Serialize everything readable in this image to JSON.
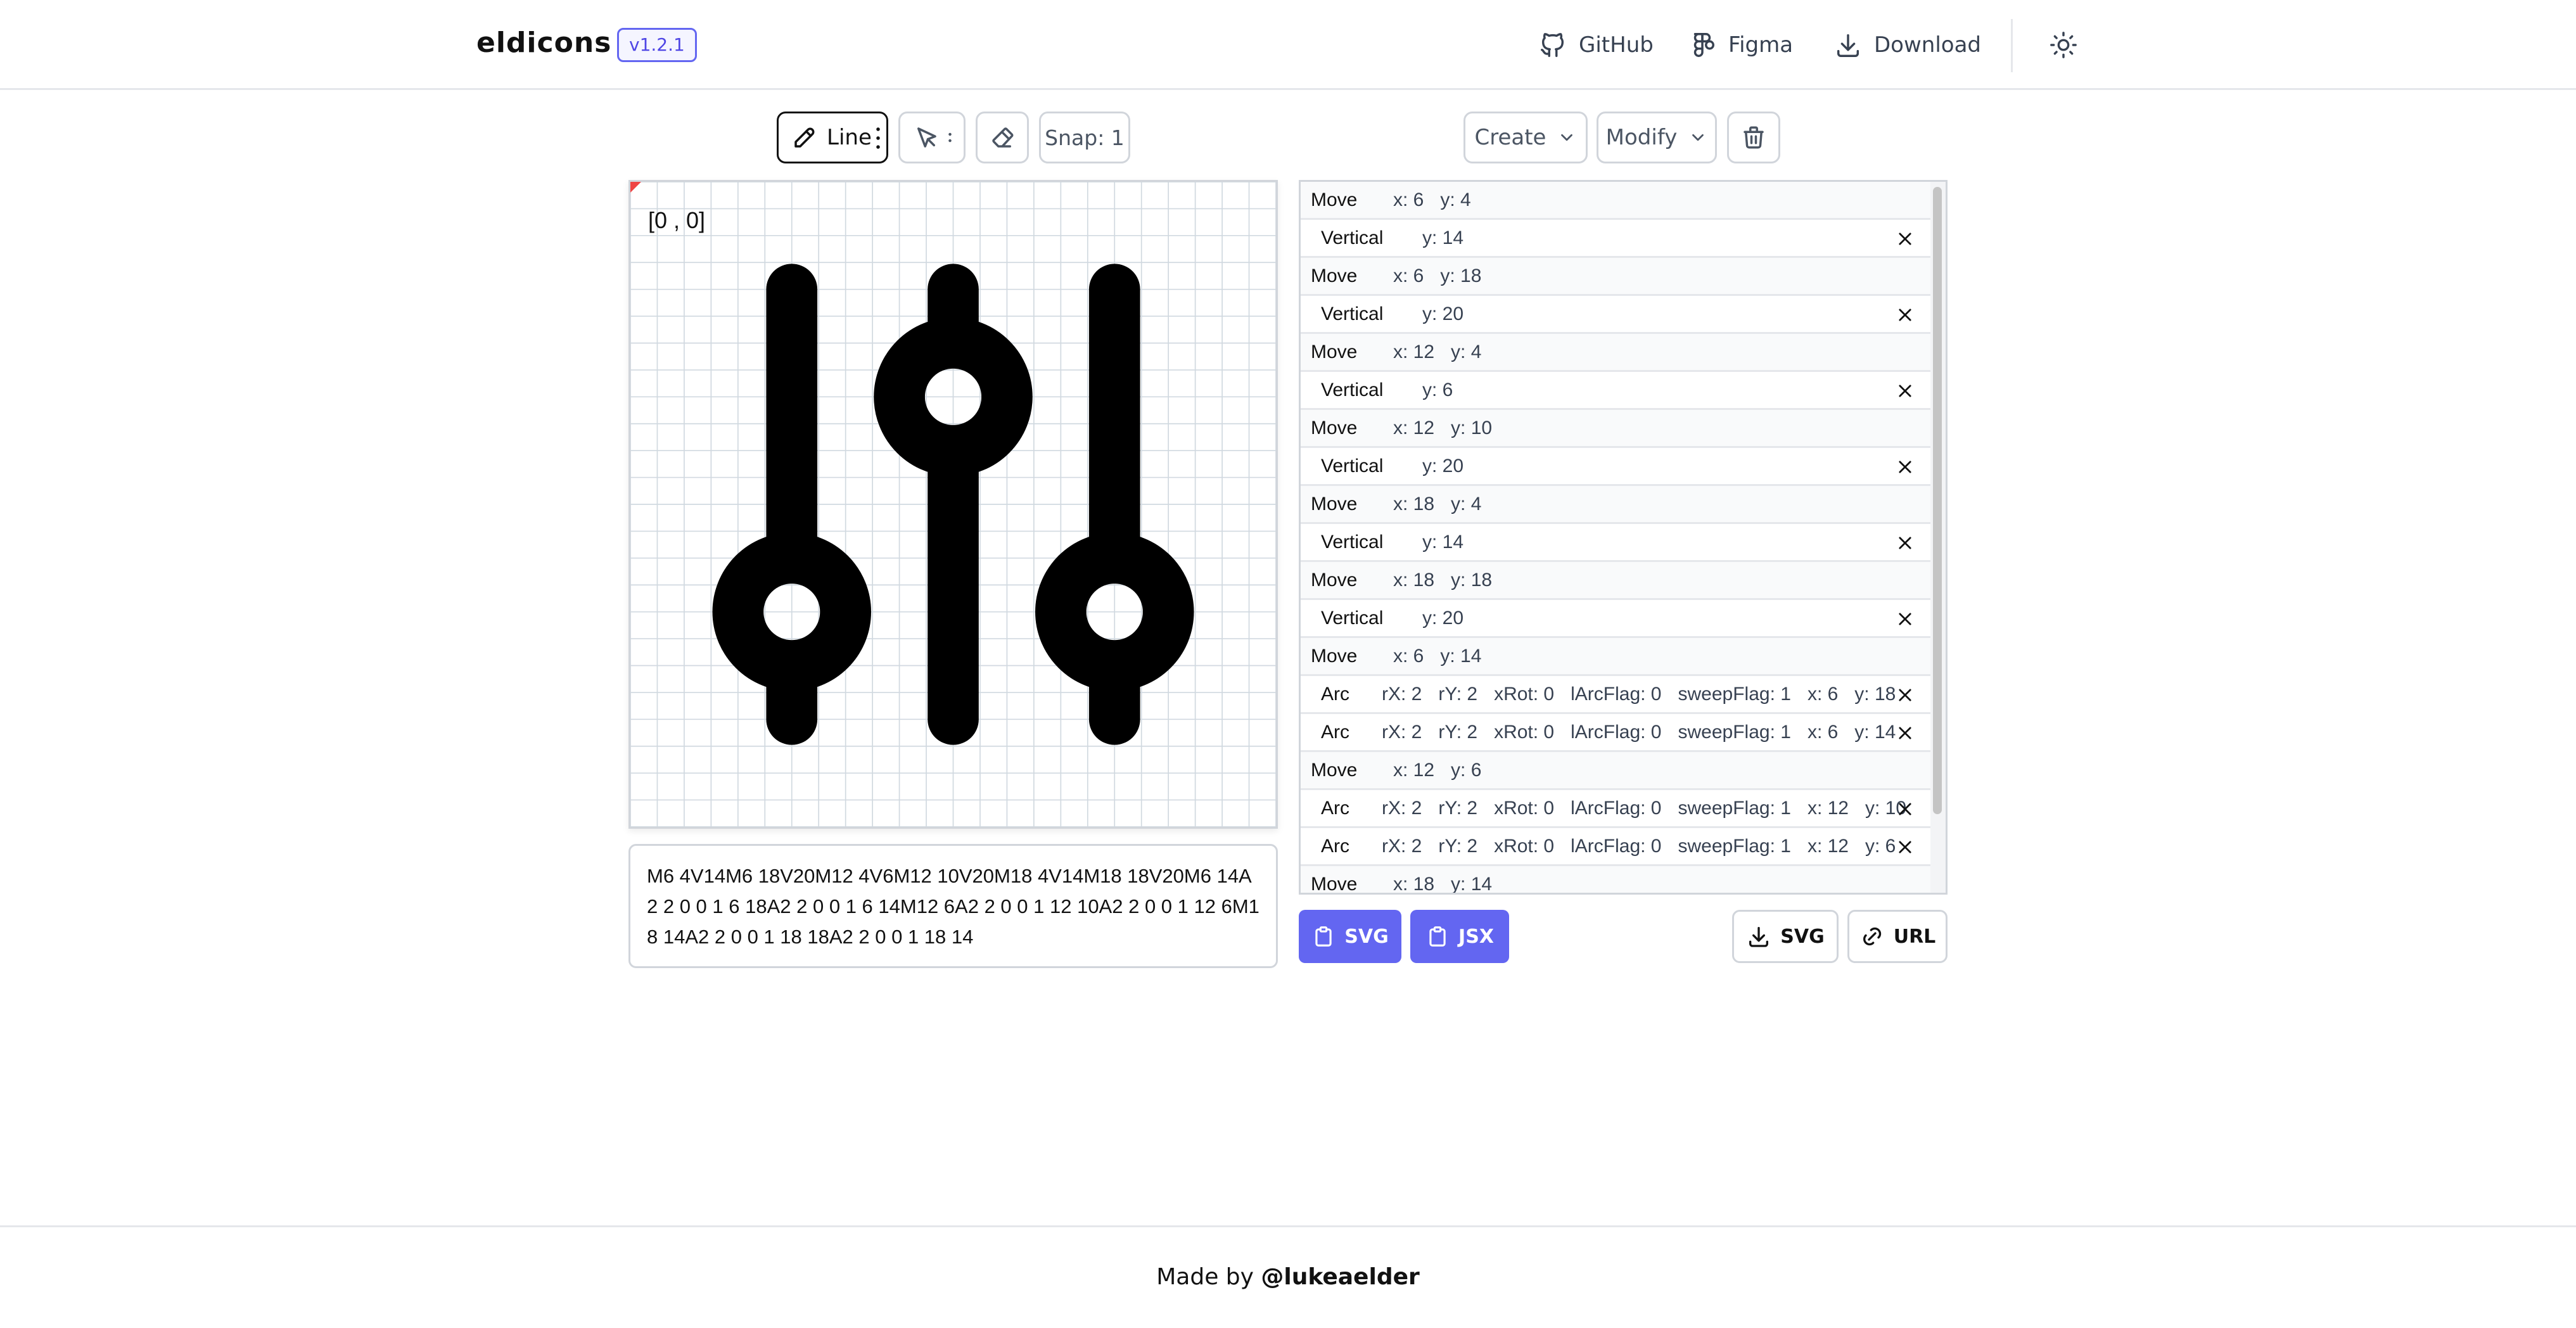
{
  "header": {
    "logo": "eldicons",
    "version": "v1.2.1",
    "links": {
      "github": "GitHub",
      "figma": "Figma",
      "download": "Download"
    }
  },
  "toolbar": {
    "line_label": "Line",
    "snap_label": "Snap: 1",
    "create_label": "Create",
    "modify_label": "Modify"
  },
  "canvas": {
    "coord_label": "[0 , 0]"
  },
  "path_text": "M6 4V14M6 18V20M12 4V6M12 10V20M18 4V14M18 18V20M6 14A2 2 0 0 1 6 18A2 2 0 0 1 6 14M12 6A2 2 0 0 1 12 10A2 2 0 0 1 12 6M18 14A2 2 0 0 1 18 18A2 2 0 0 1 18 14",
  "commands": [
    {
      "type": "Move",
      "fields": [
        "x: 6",
        "y: 4"
      ]
    },
    {
      "type": "Vertical",
      "fields": [
        "y: 14"
      ]
    },
    {
      "type": "Move",
      "fields": [
        "x: 6",
        "y: 18"
      ]
    },
    {
      "type": "Vertical",
      "fields": [
        "y: 20"
      ]
    },
    {
      "type": "Move",
      "fields": [
        "x: 12",
        "y: 4"
      ]
    },
    {
      "type": "Vertical",
      "fields": [
        "y: 6"
      ]
    },
    {
      "type": "Move",
      "fields": [
        "x: 12",
        "y: 10"
      ]
    },
    {
      "type": "Vertical",
      "fields": [
        "y: 20"
      ]
    },
    {
      "type": "Move",
      "fields": [
        "x: 18",
        "y: 4"
      ]
    },
    {
      "type": "Vertical",
      "fields": [
        "y: 14"
      ]
    },
    {
      "type": "Move",
      "fields": [
        "x: 18",
        "y: 18"
      ]
    },
    {
      "type": "Vertical",
      "fields": [
        "y: 20"
      ]
    },
    {
      "type": "Move",
      "fields": [
        "x: 6",
        "y: 14"
      ]
    },
    {
      "type": "Arc",
      "fields": [
        "rX: 2",
        "rY: 2",
        "xRot: 0",
        "lArcFlag: 0",
        "sweepFlag: 1",
        "x: 6",
        "y: 18"
      ]
    },
    {
      "type": "Arc",
      "fields": [
        "rX: 2",
        "rY: 2",
        "xRot: 0",
        "lArcFlag: 0",
        "sweepFlag: 1",
        "x: 6",
        "y: 14"
      ]
    },
    {
      "type": "Move",
      "fields": [
        "x: 12",
        "y: 6"
      ]
    },
    {
      "type": "Arc",
      "fields": [
        "rX: 2",
        "rY: 2",
        "xRot: 0",
        "lArcFlag: 0",
        "sweepFlag: 1",
        "x: 12",
        "y: 10"
      ]
    },
    {
      "type": "Arc",
      "fields": [
        "rX: 2",
        "rY: 2",
        "xRot: 0",
        "lArcFlag: 0",
        "sweepFlag: 1",
        "x: 12",
        "y: 6"
      ]
    },
    {
      "type": "Move",
      "fields": [
        "x: 18",
        "y: 14"
      ]
    }
  ],
  "copy_buttons": {
    "svg": "SVG",
    "jsx": "JSX"
  },
  "export_buttons": {
    "svg": "SVG",
    "url": "URL"
  },
  "footer": {
    "prefix": "Made by ",
    "author": "@lukeaelder"
  },
  "colors": {
    "accent": "#6366f1",
    "marker": "#ef4444",
    "grid": "#d1d9e0"
  },
  "icons": [
    "github-icon",
    "figma-icon",
    "download-icon",
    "sun-icon",
    "pencil-icon",
    "cursor-icon",
    "eraser-icon",
    "chevron-down-icon",
    "trash-icon",
    "close-icon",
    "clipboard-icon",
    "link-icon"
  ]
}
